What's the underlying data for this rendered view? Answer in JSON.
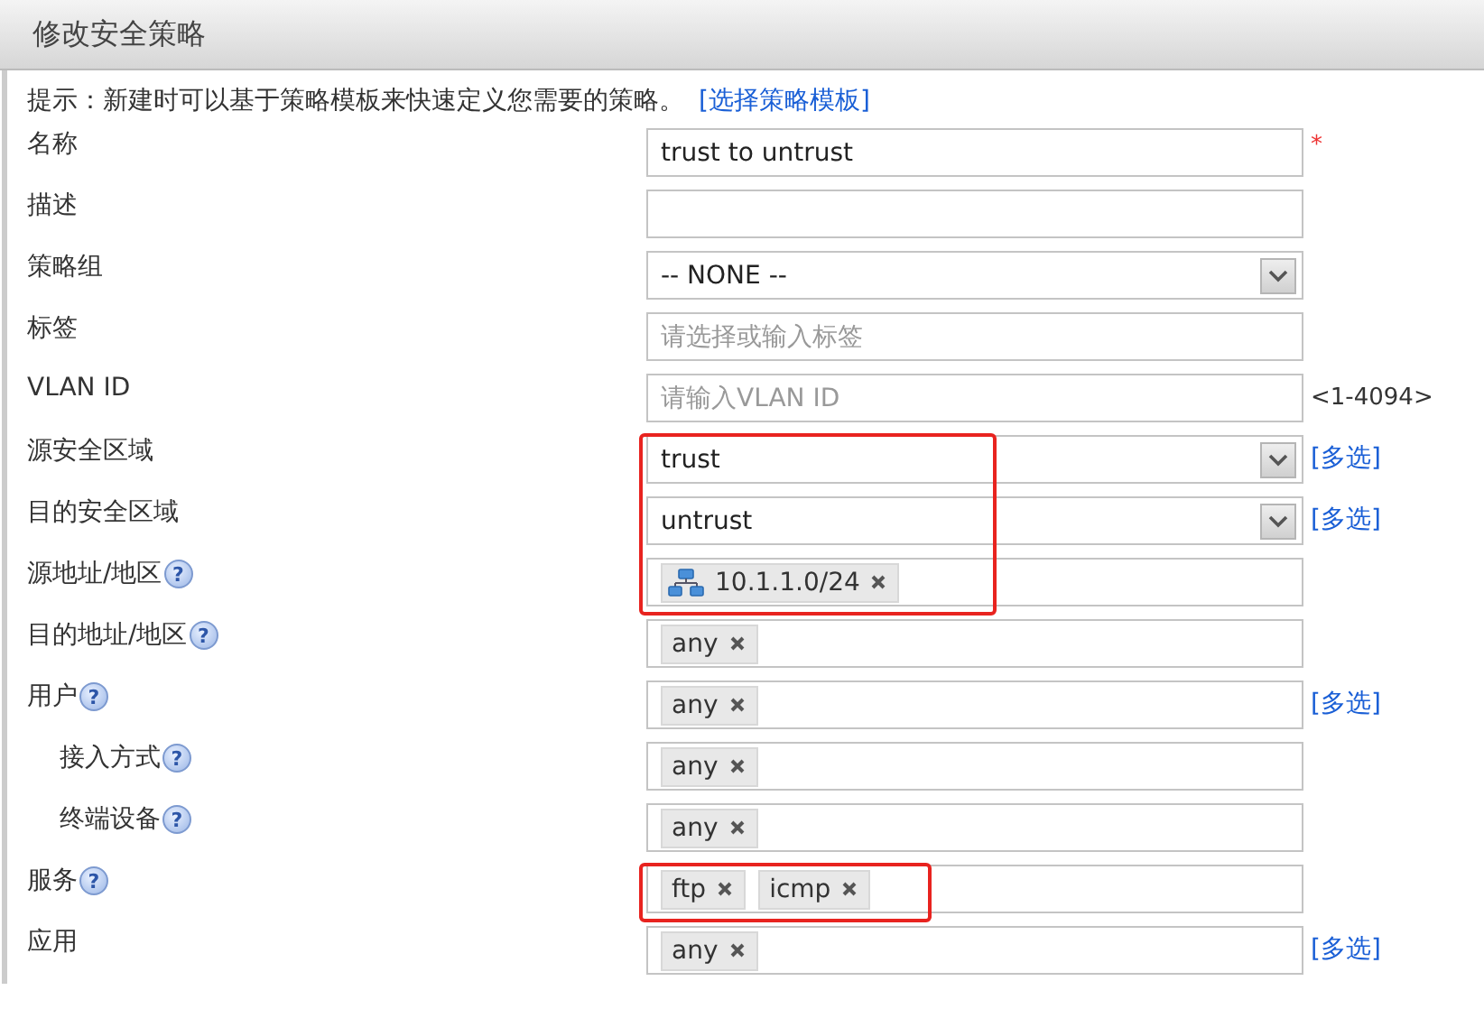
{
  "window": {
    "title": "修改安全策略"
  },
  "hint": {
    "text": "提示：新建时可以基于策略模板来快速定义您需要的策略。",
    "link": "[选择策略模板]"
  },
  "rows": [
    {
      "label": "名称",
      "kind": "input",
      "value": "trust to untrust",
      "required": "*",
      "highlighted": false
    },
    {
      "label": "描述",
      "kind": "input",
      "highlighted": false
    },
    {
      "label": "策略组",
      "kind": "select",
      "value": "-- NONE --",
      "highlighted": false
    },
    {
      "label": "标签",
      "kind": "input",
      "placeholder": "请选择或输入标签",
      "highlighted": false
    },
    {
      "label": "VLAN ID",
      "kind": "input",
      "placeholder": "请输入VLAN ID",
      "suffix": "<1-4094>",
      "highlighted": false
    },
    {
      "label": "源安全区域",
      "kind": "select",
      "value": "trust",
      "link": "[多选]",
      "highlighted": true
    },
    {
      "label": "目的安全区域",
      "kind": "select",
      "value": "untrust",
      "link": "[多选]",
      "highlighted": true
    },
    {
      "label": "源地址/地区",
      "help": "?",
      "kind": "tags",
      "tags": [
        {
          "text": "10.1.1.0/24",
          "kind": "network"
        }
      ],
      "highlighted": true
    },
    {
      "label": "目的地址/地区",
      "help": "?",
      "kind": "tags",
      "tags": [
        {
          "text": "any",
          "kind": "plain"
        }
      ],
      "highlighted": false
    },
    {
      "label": "用户",
      "help": "?",
      "kind": "tags",
      "tags": [
        {
          "text": "any",
          "kind": "plain"
        }
      ],
      "link": "[多选]",
      "highlighted": false,
      "children": [
        {
          "label": "接入方式",
          "help": "?",
          "kind": "tags",
          "tags": [
            {
              "text": "any",
              "kind": "plain"
            }
          ],
          "highlighted": false
        },
        {
          "label": "终端设备",
          "help": "?",
          "kind": "tags",
          "tags": [
            {
              "text": "any",
              "kind": "plain"
            }
          ],
          "highlighted": false
        }
      ]
    },
    {
      "label": "服务",
      "help": "?",
      "kind": "tags",
      "tags": [
        {
          "text": "ftp",
          "kind": "plain"
        },
        {
          "text": "icmp",
          "kind": "plain"
        }
      ],
      "highlighted": true
    },
    {
      "label": "应用",
      "kind": "tags",
      "tags": [
        {
          "text": "any",
          "kind": "plain"
        }
      ],
      "link": "[多选]",
      "highlighted": false
    }
  ]
}
